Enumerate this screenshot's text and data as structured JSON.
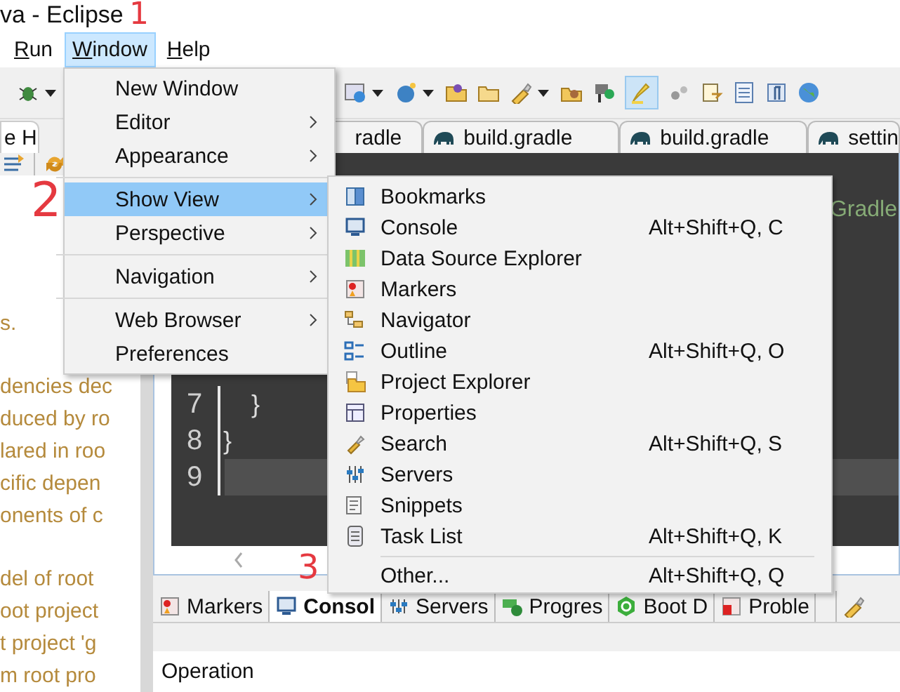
{
  "window": {
    "title": "va - Eclipse"
  },
  "menu_bar": [
    {
      "label": "Run",
      "selected": false
    },
    {
      "label": "Window",
      "selected": true
    },
    {
      "label": "Help",
      "selected": false
    }
  ],
  "toolbar": {
    "highlighter_on": true
  },
  "left_view": {
    "tab": "e H",
    "paragraphs": [
      [
        "s."
      ],
      [
        "dencies dec",
        "duced by ro",
        "lared in roo",
        "cific depen",
        "onents of c"
      ],
      [
        "del of root",
        "oot project",
        "t project 'g",
        "m root pro"
      ]
    ]
  },
  "editor_tabs": [
    {
      "label": "radle",
      "icon": false
    },
    {
      "label": "build.gradle",
      "icon": true
    },
    {
      "label": "build.gradle",
      "icon": true
    },
    {
      "label": "settin",
      "icon": true
    }
  ],
  "editor": {
    "fragment": "Gradle",
    "lines": [
      {
        "number": "7",
        "code": "    }",
        "current": false
      },
      {
        "number": "8",
        "code": "}",
        "current": false
      },
      {
        "number": "9",
        "current": true
      }
    ]
  },
  "window_menu": {
    "items": [
      {
        "label": "New Window",
        "submenu": false,
        "selected": false,
        "separator_before": false
      },
      {
        "label": "Editor",
        "submenu": true,
        "selected": false,
        "separator_before": false
      },
      {
        "label": "Appearance",
        "submenu": true,
        "selected": false,
        "separator_before": false
      },
      {
        "label": "Show View",
        "submenu": true,
        "selected": true,
        "separator_before": true
      },
      {
        "label": "Perspective",
        "submenu": true,
        "selected": false,
        "separator_before": false
      },
      {
        "label": "Navigation",
        "submenu": true,
        "selected": false,
        "separator_before": true
      },
      {
        "label": "Web Browser",
        "submenu": true,
        "selected": false,
        "separator_before": true
      },
      {
        "label": "Preferences",
        "submenu": false,
        "selected": false,
        "separator_before": false
      }
    ]
  },
  "show_view_menu": {
    "items": [
      {
        "label": "Bookmarks",
        "separator_before": false
      },
      {
        "label": "Console",
        "shortcut": "Alt+Shift+Q, C",
        "separator_before": false
      },
      {
        "label": "Data Source Explorer",
        "separator_before": false
      },
      {
        "label": "Markers",
        "separator_before": false
      },
      {
        "label": "Navigator",
        "separator_before": false
      },
      {
        "label": "Outline",
        "shortcut": "Alt+Shift+Q, O",
        "separator_before": false
      },
      {
        "label": "Project Explorer",
        "separator_before": false
      },
      {
        "label": "Properties",
        "separator_before": false
      },
      {
        "label": "Search",
        "shortcut": "Alt+Shift+Q, S",
        "separator_before": false
      },
      {
        "label": "Servers",
        "separator_before": false
      },
      {
        "label": "Snippets",
        "separator_before": false
      },
      {
        "label": "Task List",
        "shortcut": "Alt+Shift+Q, K",
        "separator_before": false
      },
      {
        "label": "Other...",
        "shortcut": "Alt+Shift+Q, Q",
        "separator_before": true
      }
    ]
  },
  "bottom_panel": {
    "tabs": [
      {
        "label": "Markers",
        "selected": false
      },
      {
        "label": "Consol",
        "selected": true
      },
      {
        "label": "Servers",
        "selected": false
      },
      {
        "label": "Progres",
        "selected": false
      },
      {
        "label": "Boot D",
        "selected": false
      },
      {
        "label": "Proble",
        "selected": false
      }
    ],
    "column": "Operation"
  },
  "annotations": [
    "1",
    "2",
    "3"
  ]
}
